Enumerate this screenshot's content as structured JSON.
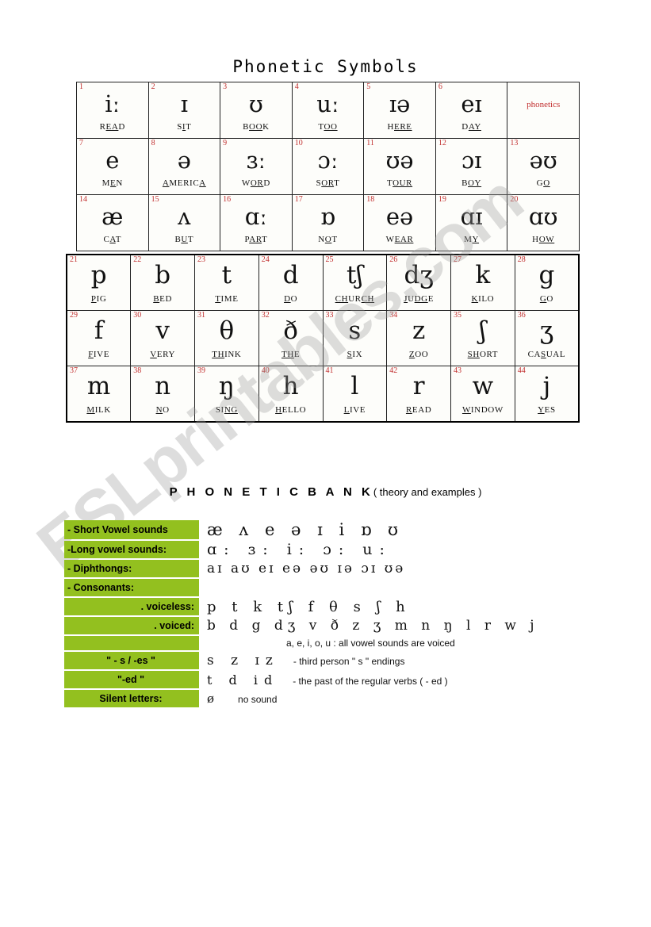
{
  "title": "Phonetic Symbols",
  "brand_cell": "phonetics",
  "vowel_rows": [
    [
      {
        "num": "1",
        "symbol": "iː",
        "word_pre": "R",
        "word_mark": "EA",
        "word_post": "D"
      },
      {
        "num": "2",
        "symbol": "ɪ",
        "word_pre": "S",
        "word_mark": "I",
        "word_post": "T"
      },
      {
        "num": "3",
        "symbol": "ʊ",
        "word_pre": "B",
        "word_mark": "OO",
        "word_post": "K"
      },
      {
        "num": "4",
        "symbol": "uː",
        "word_pre": "T",
        "word_mark": "OO",
        "word_post": ""
      },
      {
        "num": "5",
        "symbol": "ɪə",
        "word_pre": "H",
        "word_mark": "ERE",
        "word_post": ""
      },
      {
        "num": "6",
        "symbol": "eɪ",
        "word_pre": "D",
        "word_mark": "AY",
        "word_post": ""
      },
      {
        "num": "",
        "symbol": "",
        "brand": "phonetics"
      }
    ],
    [
      {
        "num": "7",
        "symbol": "e",
        "word_pre": "M",
        "word_mark": "E",
        "word_post": "N"
      },
      {
        "num": "8",
        "symbol": "ə",
        "word_pre": "",
        "word_mark": "A",
        "word_post": "MERIC",
        "word_mark2": "A"
      },
      {
        "num": "9",
        "symbol": "ɜː",
        "word_pre": "W",
        "word_mark": "OR",
        "word_post": "D"
      },
      {
        "num": "10",
        "symbol": "ɔː",
        "word_pre": "S",
        "word_mark": "OR",
        "word_post": "T"
      },
      {
        "num": "11",
        "symbol": "ʊə",
        "word_pre": "T",
        "word_mark": "OUR",
        "word_post": ""
      },
      {
        "num": "12",
        "symbol": "ɔɪ",
        "word_pre": "B",
        "word_mark": "OY",
        "word_post": ""
      },
      {
        "num": "13",
        "symbol": "əʊ",
        "word_pre": "G",
        "word_mark": "O",
        "word_post": ""
      }
    ],
    [
      {
        "num": "14",
        "symbol": "æ",
        "word_pre": "C",
        "word_mark": "A",
        "word_post": "T"
      },
      {
        "num": "15",
        "symbol": "ʌ",
        "word_pre": "B",
        "word_mark": "U",
        "word_post": "T"
      },
      {
        "num": "16",
        "symbol": "ɑː",
        "word_pre": "P",
        "word_mark": "AR",
        "word_post": "T"
      },
      {
        "num": "17",
        "symbol": "ɒ",
        "word_pre": "N",
        "word_mark": "O",
        "word_post": "T"
      },
      {
        "num": "18",
        "symbol": "eə",
        "word_pre": "W",
        "word_mark": "EAR",
        "word_post": ""
      },
      {
        "num": "19",
        "symbol": "ɑɪ",
        "word_pre": "M",
        "word_mark": "Y",
        "word_post": ""
      },
      {
        "num": "20",
        "symbol": "ɑʊ",
        "word_pre": "H",
        "word_mark": "OW",
        "word_post": ""
      }
    ]
  ],
  "consonant_rows": [
    [
      {
        "num": "21",
        "symbol": "p",
        "word_pre": "",
        "word_mark": "P",
        "word_post": "IG"
      },
      {
        "num": "22",
        "symbol": "b",
        "word_pre": "",
        "word_mark": "B",
        "word_post": "ED"
      },
      {
        "num": "23",
        "symbol": "t",
        "word_pre": "",
        "word_mark": "T",
        "word_post": "IME"
      },
      {
        "num": "24",
        "symbol": "d",
        "word_pre": "",
        "word_mark": "D",
        "word_post": "O"
      },
      {
        "num": "25",
        "symbol": "tʃ",
        "word_pre": "",
        "word_mark": "CH",
        "word_post": "UR",
        "word_mark2": "CH"
      },
      {
        "num": "26",
        "symbol": "dʒ",
        "word_pre": "",
        "word_mark": "J",
        "word_post": "U",
        "word_mark2": "DG",
        "word_post2": "E"
      },
      {
        "num": "27",
        "symbol": "k",
        "word_pre": "",
        "word_mark": "K",
        "word_post": "ILO"
      },
      {
        "num": "28",
        "symbol": "g",
        "word_pre": "",
        "word_mark": "G",
        "word_post": "O"
      }
    ],
    [
      {
        "num": "29",
        "symbol": "f",
        "word_pre": "",
        "word_mark": "F",
        "word_post": "IVE"
      },
      {
        "num": "30",
        "symbol": "v",
        "word_pre": "",
        "word_mark": "V",
        "word_post": "ERY"
      },
      {
        "num": "31",
        "symbol": "θ",
        "word_pre": "",
        "word_mark": "TH",
        "word_post": "INK"
      },
      {
        "num": "32",
        "symbol": "ð",
        "word_pre": "",
        "word_mark": "TH",
        "word_post": "E"
      },
      {
        "num": "33",
        "symbol": "s",
        "word_pre": "",
        "word_mark": "S",
        "word_post": "IX"
      },
      {
        "num": "34",
        "symbol": "z",
        "word_pre": "",
        "word_mark": "Z",
        "word_post": "OO"
      },
      {
        "num": "35",
        "symbol": "ʃ",
        "word_pre": "",
        "word_mark": "SH",
        "word_post": "ORT"
      },
      {
        "num": "36",
        "symbol": "ʒ",
        "word_pre": "CA",
        "word_mark": "S",
        "word_post": "UAL"
      }
    ],
    [
      {
        "num": "37",
        "symbol": "m",
        "word_pre": "",
        "word_mark": "M",
        "word_post": "ILK"
      },
      {
        "num": "38",
        "symbol": "n",
        "word_pre": "",
        "word_mark": "N",
        "word_post": "O"
      },
      {
        "num": "39",
        "symbol": "ŋ",
        "word_pre": "SI",
        "word_mark": "NG",
        "word_post": ""
      },
      {
        "num": "40",
        "symbol": "h",
        "word_pre": "",
        "word_mark": "H",
        "word_post": "ELLO"
      },
      {
        "num": "41",
        "symbol": "l",
        "word_pre": "",
        "word_mark": "L",
        "word_post": "IVE"
      },
      {
        "num": "42",
        "symbol": "r",
        "word_pre": "",
        "word_mark": "R",
        "word_post": "EAD"
      },
      {
        "num": "43",
        "symbol": "w",
        "word_pre": "",
        "word_mark": "W",
        "word_post": "INDOW"
      },
      {
        "num": "44",
        "symbol": "j",
        "word_pre": "",
        "word_mark": "Y",
        "word_post": "ES"
      }
    ]
  ],
  "bank": {
    "heading_main": "P H O N E T I C   B A N K",
    "heading_sub": "( theory and examples )",
    "rows": {
      "short_vowel_label": "- Short Vowel sounds",
      "short_vowel_value": "æ ʌ e ə ɪ i ɒ ʊ",
      "long_vowel_label": "-Long vowel sounds:",
      "long_vowel_value": "ɑ: ɜ: i: ɔ: u:",
      "diphthongs_label": "- Diphthongs:",
      "diphthongs_value": "aɪ aʊ eɪ eə əʊ ɪə ɔɪ ʊə",
      "consonants_label": "- Consonants:",
      "consonants_value": "",
      "voiceless_label": ". voiceless:",
      "voiceless_value": "p t k tʃ f θ s ʃ h",
      "voiced_label": ". voiced:",
      "voiced_value": "b d g dʒ v ð z ʒ m n ŋ l r w j",
      "vowels_note_label": "",
      "vowels_note": "a, e, i, o, u : all vowel sounds are voiced",
      "s_es_label": "\" - s / -es \"",
      "s_es_value": "s z ɪz",
      "s_es_note": "- third person \" s \" endings",
      "ed_label": "\"-ed \"",
      "ed_value": "t d id",
      "ed_note": "- the past of the regular verbs ( - ed )",
      "silent_label": "Silent letters:",
      "silent_value": "ø",
      "silent_note": "no sound"
    }
  },
  "watermark": "ESLprintables.com",
  "colors": {
    "green": "#93c01f",
    "red": "#c23030"
  }
}
